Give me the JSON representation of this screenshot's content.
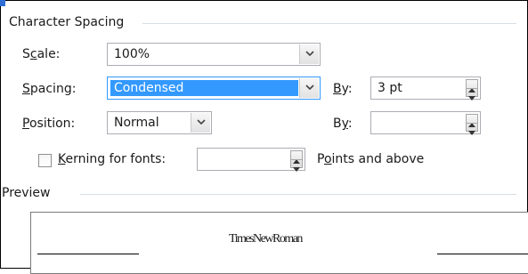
{
  "character_spacing": {
    "title": "Character Spacing",
    "scale": {
      "label_before": "S",
      "label_mn": "c",
      "label_after": "ale:",
      "value": "100%"
    },
    "spacing": {
      "label_mn": "S",
      "label_rest": "pacing:",
      "value": "Condensed",
      "by_mn": "B",
      "by_rest": "y:",
      "by_value": "3 pt"
    },
    "position": {
      "label_mn": "P",
      "label_rest": "osition:",
      "value": "Normal",
      "by_before": "B",
      "by_mn": "y",
      "by_after": ":",
      "by_value": ""
    },
    "kerning": {
      "label_mn": "K",
      "label_rest": "erning for fonts:",
      "value": "",
      "suffix_before": "P",
      "suffix_mn": "o",
      "suffix_after": "ints and above",
      "checked": false
    }
  },
  "preview": {
    "title": "Preview",
    "sample_text": "TimesNewRoman"
  },
  "colors": {
    "selection": "#3399ff",
    "group_line": "#d5dfe5",
    "accent_strip": "#2f6fd6"
  }
}
